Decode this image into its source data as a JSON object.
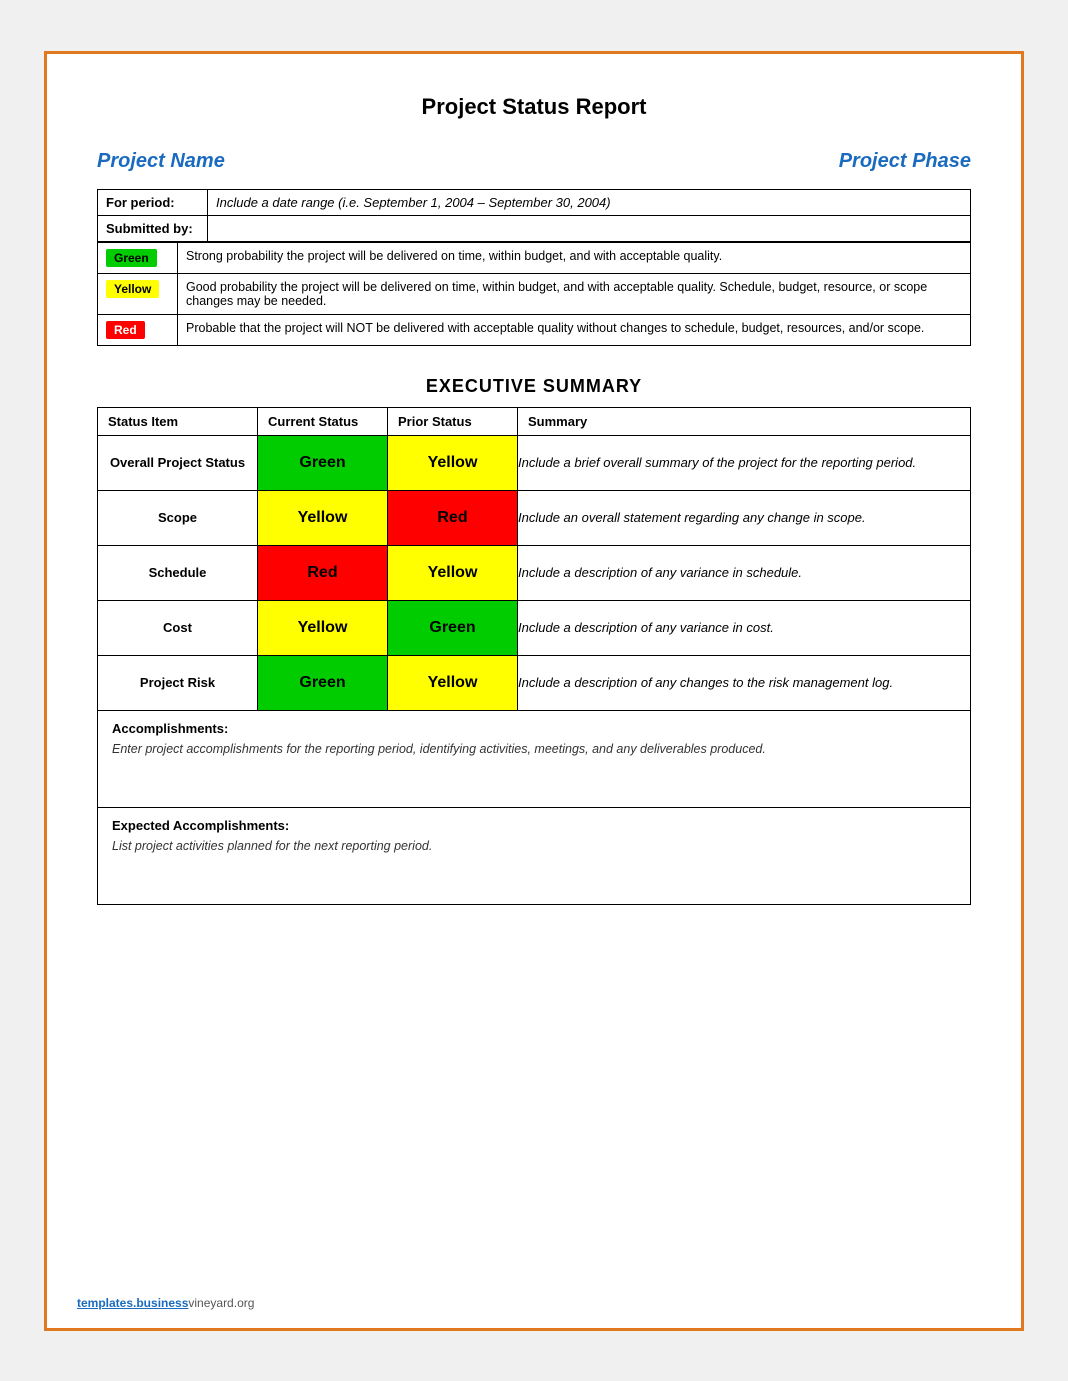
{
  "page": {
    "title": "Project Status Report",
    "border_color": "#e07820"
  },
  "project_header": {
    "name_label": "Project Name",
    "phase_label": "Project Phase"
  },
  "info_rows": [
    {
      "label": "For period:",
      "value": "Include a date range (i.e. September 1, 2004 – September 30, 2004)"
    },
    {
      "label": "Submitted by:",
      "value": ""
    }
  ],
  "legend": [
    {
      "badge": "Green",
      "color": "green",
      "description": "Strong probability the project will be delivered on time, within budget, and with acceptable quality."
    },
    {
      "badge": "Yellow",
      "color": "yellow",
      "description": "Good probability the project will be delivered on time, within budget, and with acceptable quality. Schedule, budget, resource, or scope changes may be needed."
    },
    {
      "badge": "Red",
      "color": "red",
      "description": "Probable that the project will NOT be delivered with acceptable quality without changes to schedule, budget, resources, and/or scope."
    }
  ],
  "executive_summary": {
    "title": "EXECUTIVE SUMMARY",
    "columns": [
      "Status Item",
      "Current Status",
      "Prior Status",
      "Summary"
    ],
    "rows": [
      {
        "item": "Overall Project Status",
        "current_status": "Green",
        "current_color": "green",
        "prior_status": "Yellow",
        "prior_color": "yellow",
        "summary": "Include a brief overall summary of the project for the reporting period."
      },
      {
        "item": "Scope",
        "current_status": "Yellow",
        "current_color": "yellow",
        "prior_status": "Red",
        "prior_color": "red",
        "summary": "Include an overall statement regarding any change in scope."
      },
      {
        "item": "Schedule",
        "current_status": "Red",
        "current_color": "red",
        "prior_status": "Yellow",
        "prior_color": "yellow",
        "summary": "Include a description of any variance in schedule."
      },
      {
        "item": "Cost",
        "current_status": "Yellow",
        "current_color": "yellow",
        "prior_status": "Green",
        "prior_color": "green",
        "summary": "Include a description of any variance in cost."
      },
      {
        "item": "Project Risk",
        "current_status": "Green",
        "current_color": "green",
        "prior_status": "Yellow",
        "prior_color": "yellow",
        "summary": "Include a description of any changes to the risk management log."
      }
    ]
  },
  "accomplishments": {
    "title": "Accomplishments:",
    "text": "Enter project accomplishments for the reporting period, identifying activities, meetings, and any deliverables produced."
  },
  "expected_accomplishments": {
    "title": "Expected Accomplishments:",
    "text": "List project activities planned for the next reporting period."
  },
  "footer": {
    "brand": "templates.business",
    "suffix": "vineyard.org"
  }
}
